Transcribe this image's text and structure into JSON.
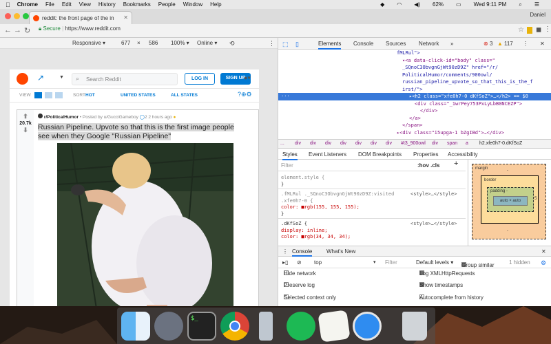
{
  "menubar": {
    "apple": "",
    "app": "Chrome",
    "items": [
      "File",
      "Edit",
      "View",
      "History",
      "Bookmarks",
      "People",
      "Window",
      "Help"
    ],
    "battery": "62%",
    "clock": "Wed 9:11 PM"
  },
  "browser": {
    "tab_title": "reddit: the front page of the in",
    "profile": "Daniel",
    "secure_label": "Secure",
    "url": "https://www.reddit.com"
  },
  "device_toolbar": {
    "device": "Responsive ▾",
    "width": "677",
    "x": "×",
    "height": "586",
    "zoom": "100% ▾",
    "network": "Online ▾"
  },
  "reddit": {
    "search_placeholder": "Search Reddit",
    "login": "LOG IN",
    "signup": "SIGN UP",
    "view_label": "VIEW",
    "sort_label": "SORT",
    "sort_value": "HOT",
    "region": "UNITED STATES",
    "states": "ALL STATES",
    "post": {
      "score": "20.7k",
      "subreddit": "r/PoliticalHumor",
      "byline": "• Posted by u/GucciGameboy",
      "comments_count": "2",
      "time": "2 hours ago",
      "title": "Russian Pipeline. Upvote so that this is the first image people see when they Google \"Russian Pipeline\""
    }
  },
  "devtools": {
    "tabs": [
      "Elements",
      "Console",
      "Sources",
      "Network"
    ],
    "errors": "3",
    "warnings": "117",
    "code_lines": [
      "fMLRul\">",
      "▾<a data-click-id=\"body\" class=\"",
      "_SQnoC3ObvgnGjWt90zD9Z\" href=\"/r/",
      "PoliticalHumor/comments/900owl/",
      "russian_pipeline_upvote_so_that_this_is_the_f",
      "irst/\">",
      "▸<h2 class=\"xfe0h7-0 dKfSoZ\">…</h2> == $0",
      "<div class=\"_1wrPey753PxLyLbB0NCEZP\">",
      "</div>",
      "</a>",
      "</span>",
      "▸<div class=\"i5upga-1 bZgIBd\">…</div>",
      "</div>"
    ],
    "breadcrumbs": [
      "...",
      "div",
      "div",
      "div",
      "div",
      "div",
      "div",
      "div",
      "#t3_900owl",
      "div",
      "span",
      "a",
      "h2.xfe0h7-0.dKfSoZ"
    ],
    "style_tabs": [
      "Styles",
      "Event Listeners",
      "DOM Breakpoints",
      "Properties",
      "Accessibility"
    ],
    "filter_placeholder": "Filter",
    "hov_cls": ":hov .cls",
    "styles_lines": [
      "element.style {",
      "}",
      ".fMLRul ._SQnoC3ObvgnGjWt90zD9Z:visited",
      ".xfe0h7-0 {",
      "  color: ■rgb(155, 155, 155);",
      "}",
      ".dKfSoZ {",
      "  display: inline;",
      "  color: ■rgb(34, 34, 34);"
    ],
    "style_source": "<style>…</style>",
    "boxmodel": {
      "margin": "margin",
      "border": "border",
      "padding": "padding -",
      "content": "auto × auto",
      "dash": "-",
      "right": "5"
    },
    "console_tabs": [
      "Console",
      "What's New"
    ],
    "context": "top",
    "console_filter": "Filter",
    "levels": "Default levels ▾",
    "group_similar": "Group similar",
    "hidden": "1 hidden",
    "options_left": [
      "Hide network",
      "Preserve log",
      "Selected context only"
    ],
    "options_right": [
      "Log XMLHttpRequests",
      "Show timestamps",
      "Autocomplete from history"
    ]
  },
  "dock": {
    "apps": [
      "finder-icon",
      "launchpad-icon",
      "terminal-icon",
      "chrome-icon",
      "simulator-icon",
      "spotify-icon",
      "textedit-icon",
      "safari-icon",
      "trash-icon"
    ]
  }
}
